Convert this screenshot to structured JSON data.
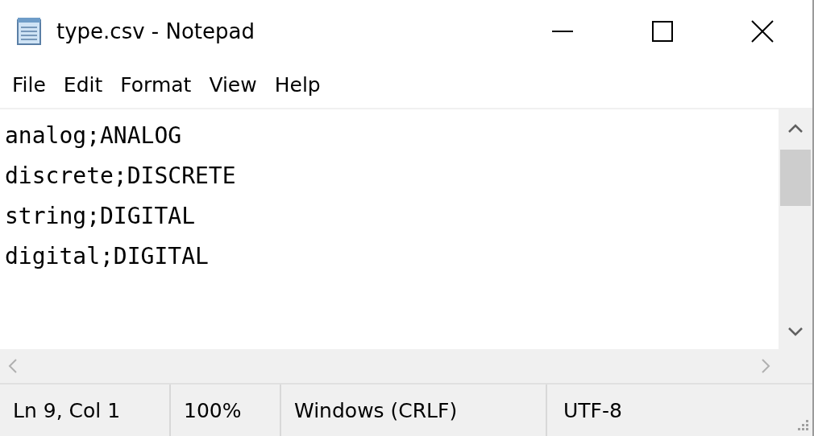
{
  "window": {
    "title": "type.csv - Notepad"
  },
  "menu": [
    "File",
    "Edit",
    "Format",
    "View",
    "Help"
  ],
  "editor": {
    "lines": [
      "analog;ANALOG",
      "discrete;DISCRETE",
      "string;DIGITAL",
      "digital;DIGITAL"
    ]
  },
  "status_bar": [
    "Ln 9, Col 1",
    "100%",
    "Windows (CRLF)",
    "UTF-8"
  ]
}
